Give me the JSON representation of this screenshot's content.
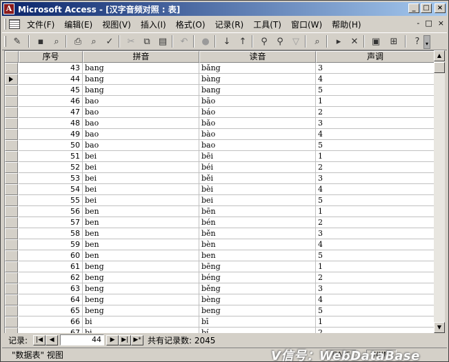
{
  "window": {
    "title": "Microsoft Access - [汉字音频对照 : 表]",
    "minimize_glyph": "_",
    "maximize_glyph": "□",
    "close_glyph": "×",
    "app_icon_glyph": "A"
  },
  "menu": {
    "items": [
      "文件(F)",
      "编辑(E)",
      "视图(V)",
      "插入(I)",
      "格式(O)",
      "记录(R)",
      "工具(T)",
      "窗口(W)",
      "帮助(H)"
    ],
    "right_controls": [
      "-",
      "□",
      "×"
    ]
  },
  "toolbar": {
    "icons": [
      {
        "name": "view-icon",
        "glyph": "✎"
      },
      {
        "name": "save-icon",
        "glyph": "▪"
      },
      {
        "name": "search-db-icon",
        "glyph": "⌕"
      },
      {
        "name": "print-icon",
        "glyph": "⎙"
      },
      {
        "name": "print-preview-icon",
        "glyph": "⌕"
      },
      {
        "name": "spelling-icon",
        "glyph": "✓"
      },
      {
        "name": "cut-icon",
        "glyph": "✂"
      },
      {
        "name": "copy-icon",
        "glyph": "⧉"
      },
      {
        "name": "paste-icon",
        "glyph": "▤"
      },
      {
        "name": "undo-icon",
        "glyph": "↶"
      },
      {
        "name": "hyperlink-icon",
        "glyph": "●"
      },
      {
        "name": "sort-ascending-icon",
        "glyph": "↓"
      },
      {
        "name": "sort-descending-icon",
        "glyph": "↑"
      },
      {
        "name": "filter-by-selection-icon",
        "glyph": "⚲"
      },
      {
        "name": "filter-by-form-icon",
        "glyph": "⚲"
      },
      {
        "name": "apply-filter-icon",
        "glyph": "▽"
      },
      {
        "name": "find-icon",
        "glyph": "⌕"
      },
      {
        "name": "new-record-icon",
        "glyph": "▸"
      },
      {
        "name": "delete-record-icon",
        "glyph": "✕"
      },
      {
        "name": "database-window-icon",
        "glyph": "▣"
      },
      {
        "name": "new-object-icon",
        "glyph": "⊞"
      },
      {
        "name": "help-icon",
        "glyph": "?"
      }
    ]
  },
  "table": {
    "columns": [
      "序号",
      "拼音",
      "读音",
      "声调"
    ],
    "current_row_index": 1,
    "rows": [
      [
        "43",
        "bang",
        "bǎng",
        "3"
      ],
      [
        "44",
        "bang",
        "bàng",
        "4"
      ],
      [
        "45",
        "bang",
        "bang",
        "5"
      ],
      [
        "46",
        "bao",
        "bāo",
        "1"
      ],
      [
        "47",
        "bao",
        "báo",
        "2"
      ],
      [
        "48",
        "bao",
        "bǎo",
        "3"
      ],
      [
        "49",
        "bao",
        "bào",
        "4"
      ],
      [
        "50",
        "bao",
        "bao",
        "5"
      ],
      [
        "51",
        "bei",
        "bēi",
        "1"
      ],
      [
        "52",
        "bei",
        "béi",
        "2"
      ],
      [
        "53",
        "bei",
        "běi",
        "3"
      ],
      [
        "54",
        "bei",
        "bèi",
        "4"
      ],
      [
        "55",
        "bei",
        "bei",
        "5"
      ],
      [
        "56",
        "ben",
        "bēn",
        "1"
      ],
      [
        "57",
        "ben",
        "bén",
        "2"
      ],
      [
        "58",
        "ben",
        "běn",
        "3"
      ],
      [
        "59",
        "ben",
        "bèn",
        "4"
      ],
      [
        "60",
        "ben",
        "ben",
        "5"
      ],
      [
        "61",
        "beng",
        "bēng",
        "1"
      ],
      [
        "62",
        "beng",
        "béng",
        "2"
      ],
      [
        "63",
        "beng",
        "běng",
        "3"
      ],
      [
        "64",
        "beng",
        "bèng",
        "4"
      ],
      [
        "65",
        "beng",
        "beng",
        "5"
      ],
      [
        "66",
        "bi",
        "bī",
        "1"
      ],
      [
        "67",
        "bi",
        "bí",
        "2"
      ]
    ]
  },
  "scrollbar": {
    "up_glyph": "▲",
    "down_glyph": "▼"
  },
  "navigation": {
    "label": "记录:",
    "first_glyph": "|◀",
    "prev_glyph": "◀",
    "current_record": "44",
    "next_glyph": "▶",
    "last_glyph": "▶|",
    "new_glyph": "▶*",
    "total_text": "共有记录数: 2045"
  },
  "status": {
    "text": "\"数据表\" 视图",
    "panels": [
      "CAPS",
      "NUM"
    ]
  },
  "watermark": "V信号：WebDataBase"
}
